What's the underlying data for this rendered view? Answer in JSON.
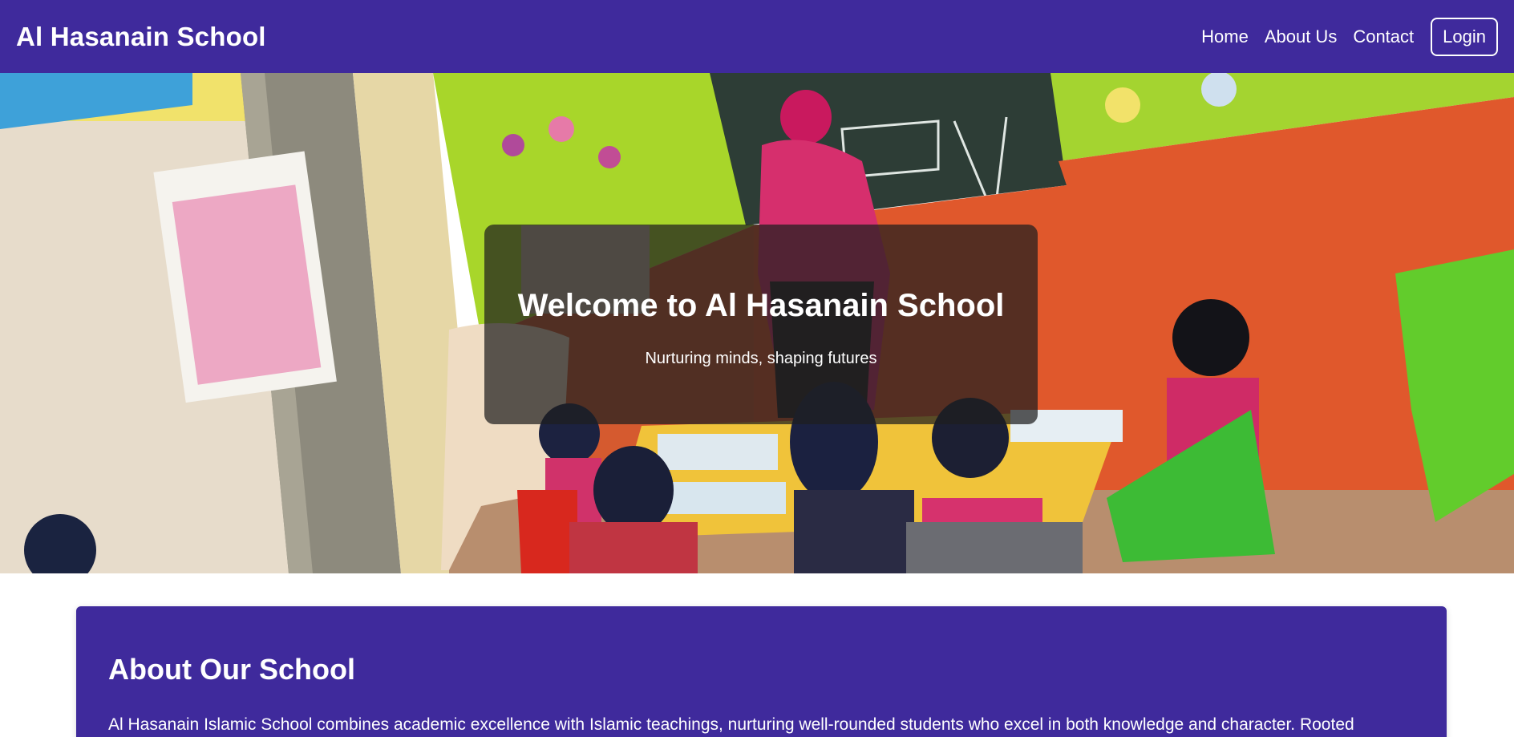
{
  "navbar": {
    "brand": "Al Hasanain School",
    "links": [
      "Home",
      "About Us",
      "Contact"
    ],
    "login_label": "Login",
    "background": "#3f2a9c"
  },
  "hero": {
    "title": "Welcome to Al Hasanain School",
    "subtitle": "Nurturing minds, shaping futures",
    "image_description": "classroom-photo"
  },
  "about": {
    "title": "About Our School",
    "text": "Al Hasanain Islamic School combines academic excellence with Islamic teachings, nurturing well-rounded students who excel in both knowledge and character. Rooted"
  },
  "colors": {
    "primary": "#3f2a9c",
    "overlay": "#1e1e1e"
  }
}
